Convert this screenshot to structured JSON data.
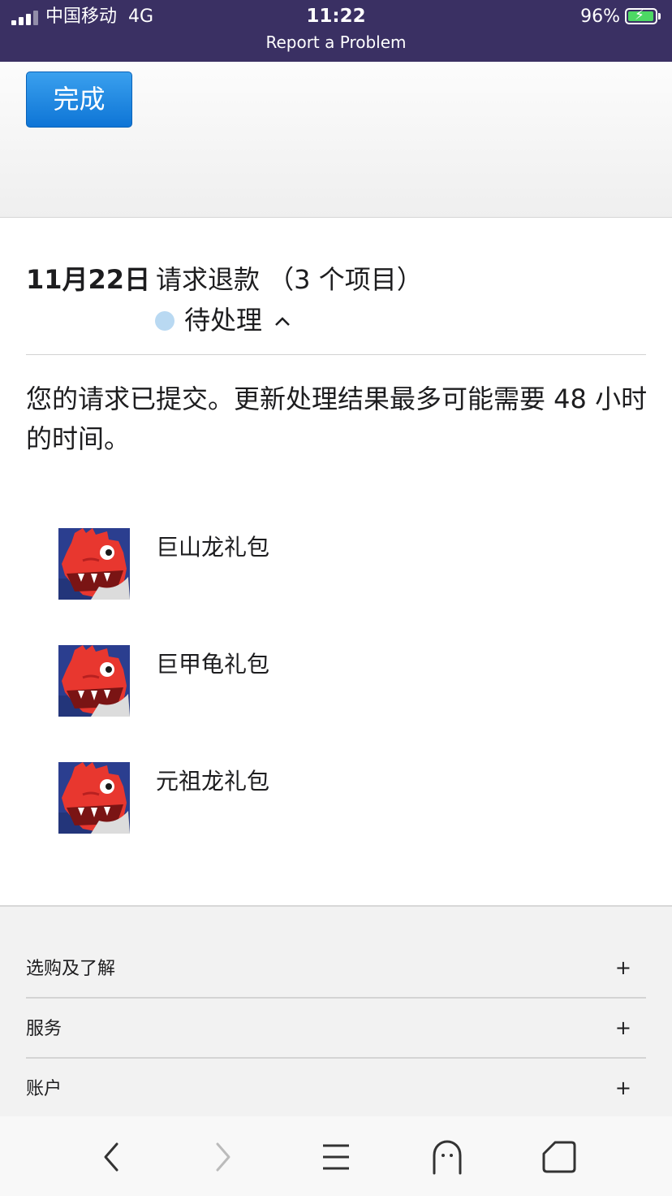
{
  "status_bar": {
    "carrier": "中国移动",
    "network": "4G",
    "time": "11:22",
    "battery_percent": "96%",
    "battery_level": 0.96,
    "page_title": "Report a Problem",
    "bar_color": "#3a3063"
  },
  "header": {
    "done_label": "完成",
    "button_color": "#1a80dc"
  },
  "request": {
    "date": "11月22日",
    "title": "请求退款 （3 个项目）",
    "status": "待处理",
    "status_color": "#b9d9f2",
    "message": "您的请求已提交。更新处理结果最多可能需要 48 小时的时间。"
  },
  "items": [
    {
      "name": "巨山龙礼包",
      "icon": "red-dragon-game-icon"
    },
    {
      "name": "巨甲龟礼包",
      "icon": "red-dragon-game-icon"
    },
    {
      "name": "元祖龙礼包",
      "icon": "red-dragon-game-icon"
    }
  ],
  "footer": {
    "sections": [
      {
        "label": "选购及了解",
        "action": "+"
      },
      {
        "label": "服务",
        "action": "+"
      },
      {
        "label": "账户",
        "action": "+"
      }
    ]
  },
  "browser_toolbar": {
    "icons": [
      "back-icon",
      "forward-icon",
      "menu-icon",
      "ghost-icon",
      "home-icon"
    ]
  }
}
